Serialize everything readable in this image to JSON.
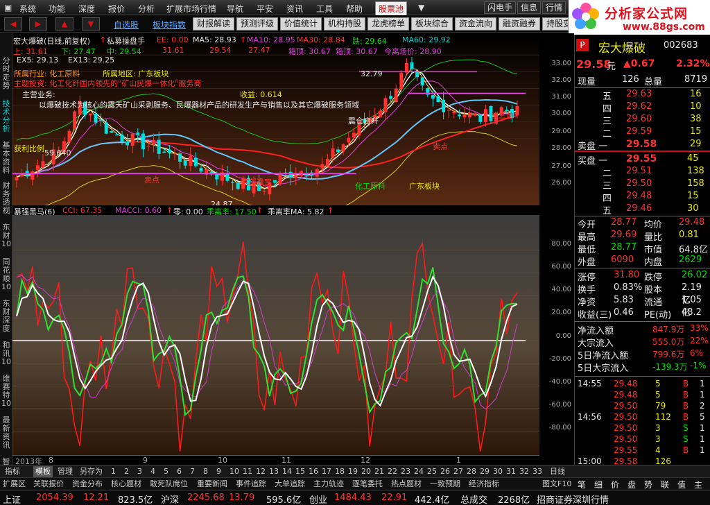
{
  "menu": [
    "系统",
    "功能",
    "深度",
    "报价",
    "分析",
    "扩展市场行情",
    "导航",
    "平安",
    "资讯",
    "工具",
    "帮助"
  ],
  "menu_highlight": "股票池",
  "menu_right": [
    "闪电手",
    "信息",
    "行情"
  ],
  "logo": {
    "title": "分析家公式网",
    "url": "www.88gs.com"
  },
  "toolbar": {
    "arrows": [
      "◀",
      "▶",
      "▲",
      "▼"
    ],
    "links": [
      "自选股",
      "板块指数"
    ],
    "tabs": [
      "财报解读",
      "预测评级",
      "价值统计",
      "机构持股",
      "龙虎榜单",
      "板块综合",
      "资金流向",
      "融资融券",
      "持股变"
    ]
  },
  "left_tabs": [
    "分时走势",
    "技术分析",
    "基本资料",
    "财务透视",
    "东财10",
    "同花顺10",
    "东财深度",
    "和讯10",
    "维赛特10",
    "最新资讯",
    "智能"
  ],
  "main_header": {
    "stock": "宏大爆破(日线,前复权)",
    "tool": "私募操盘手",
    "ee": "EE: 0.00",
    "ma5": "MA5: 28.93",
    "ma10": "MA10: 28.95",
    "ma30": "MA30: 28.84",
    "die": "跌: 29.64",
    "ma60": "MA60: 29.92",
    "shang": "上: 31.61",
    "xia": "下: 27.47",
    "zhong": "中: 29.54",
    "v1": "31.61",
    "v2": "29.54",
    "v3": "27.47",
    "xiangding": "箱顶: 30.67",
    "xiangdi": "箱顶: 30.67",
    "jinlichang": "今离场价: 28.90",
    "ex5": "EX5: 29.13",
    "ex13": "EX13: 29.25"
  },
  "chart_ann": {
    "industry": "所属行业: 化工原料",
    "region": "所属地区: 广东板块",
    "theme": "主题投资: 化工化纤国内领先的\"矿山民爆一体化\"服务商",
    "business_label": "主营业务:",
    "business": "以爆破技术为核心的露天矿山采剥服务、民爆器材产品的研发生产与销售以及其它爆破服务领域",
    "income": "收益: 0.614",
    "ratio": "获利比例",
    "ratio_val": "59.640",
    "high_label": "32.79",
    "low_label": "24.87",
    "cang": "震仓启升",
    "chemical": "化工原料",
    "guangdong": "广东板块",
    "sell1": "卖点",
    "sell2": "卖点",
    "buy": "底部逢宝",
    "zhang": "涨三角"
  },
  "indicator_header": {
    "name": "暴强黑马(6)",
    "cci": "CCI: 67.35",
    "macci": "MACCI: 0.60",
    "zero": "零: 0.00",
    "guai": "乖离率: 17.50",
    "guaima": "乖离率MA: 5.82"
  },
  "price_axis": [
    "33.00",
    "32.00",
    "31.00",
    "30.00",
    "29.00",
    "28.00",
    "27.00",
    "26.00"
  ],
  "ind_axis": [
    "80.00",
    "60.00",
    "40.00",
    "20.00",
    "0.00",
    "-20.00",
    "-40.00",
    "-60.00",
    "-80.00"
  ],
  "time_axis": [
    "2013年",
    "8",
    "9",
    "10",
    "11",
    "12",
    "1"
  ],
  "bottom_tabs": [
    "指标",
    "模板",
    "管理",
    "另存为"
  ],
  "bottom_nums": [
    "1",
    "2",
    "3",
    "4",
    "5",
    "6",
    "7",
    "8",
    "9",
    "10",
    "11",
    "12",
    "13",
    "14",
    "15",
    "16",
    "17",
    "18",
    "19",
    "20",
    "21",
    "22",
    "23",
    "24",
    "25",
    "26",
    "27",
    "28",
    "29",
    "30",
    "31",
    "32",
    "33"
  ],
  "day_label": "日线",
  "bottom_tabs2": [
    "扩展区",
    "关联报价",
    "资金分布",
    "核心题材",
    "敢死队席位",
    "重要新闻",
    "事件追踪",
    "大单追踪",
    "主力轨迹",
    "逐笔委托",
    "热点题材",
    "一致预期",
    "经济指标"
  ],
  "bottom_right2": "图文F10",
  "status": {
    "sh": "上证",
    "sh_v": "2054.39",
    "sh_c": "12.21",
    "sh_a": "823.5亿",
    "hs": "沪深",
    "hs_v": "2245.68",
    "hs_c": "13.79",
    "hs_a": "595.6亿",
    "cy": "创业",
    "cy_v": "1484.43",
    "cy_c": "22.91",
    "cy_a": "442.4亿",
    "total": "总成交",
    "total_v": "2268亿",
    "broker": "招商证券深圳行情"
  },
  "quote": {
    "flag": "P",
    "name": "宏大爆破",
    "code": "002683",
    "price": "29.58",
    "unit": "元",
    "change": "▲0.67",
    "pct": "2.32%",
    "xianliang_l": "现量",
    "xianliang": "126",
    "zongliang_l": "总量",
    "zongliang": "8719",
    "asks": [
      {
        "l": "五",
        "p": "29.63",
        "v": "16"
      },
      {
        "l": "四",
        "p": "29.62",
        "v": "10"
      },
      {
        "l": "三",
        "p": "29.60",
        "v": "38"
      },
      {
        "l": "二",
        "p": "29.59",
        "v": "15"
      },
      {
        "l": "卖盘 一",
        "p": "29.58",
        "v": "29"
      }
    ],
    "bids": [
      {
        "l": "买盘 一",
        "p": "29.55",
        "v": "45"
      },
      {
        "l": "二",
        "p": "29.51",
        "v": "138"
      },
      {
        "l": "三",
        "p": "29.50",
        "v": "158"
      },
      {
        "l": "四",
        "p": "29.48",
        "v": "15"
      },
      {
        "l": "五",
        "p": "29.46",
        "v": "30"
      }
    ],
    "stats": [
      [
        "今开",
        "28.77",
        "均价",
        "29.48"
      ],
      [
        "最高",
        "29.69",
        "量比",
        "0.81"
      ],
      [
        "最低",
        "28.77",
        "市值",
        "64.8亿"
      ],
      [
        "外盘",
        "6090",
        "内盘",
        "2629"
      ]
    ],
    "stats2": [
      [
        "涨停",
        "31.80",
        "跌停",
        "26.02"
      ],
      [
        "换手",
        "0.83%",
        "股本",
        "2.19亿"
      ],
      [
        "净资",
        "5.83",
        "流通",
        "1.05亿"
      ],
      [
        "收益(三)",
        "0.46",
        "PE(动)",
        "48.2"
      ]
    ],
    "flows": [
      [
        "净流入额",
        "847.9万",
        "33%"
      ],
      [
        "大宗流入",
        "555.0万",
        "22%"
      ],
      [
        "5日净流入额",
        "799.6万",
        "6%"
      ],
      [
        "5日大宗流入",
        "-139.3万",
        "-1%"
      ]
    ],
    "ticks": [
      [
        "14:55",
        "29.48",
        "5",
        "B",
        "1"
      ],
      [
        "",
        "29.48",
        "5",
        "B",
        "1"
      ],
      [
        "",
        "29.50",
        "79",
        "B",
        "2"
      ],
      [
        "14:56",
        "29.50",
        "112",
        "B",
        "5"
      ],
      [
        "",
        "29.50",
        "3",
        "S",
        "1"
      ],
      [
        "",
        "29.50",
        "3",
        "S",
        "1"
      ],
      [
        "",
        "29.55",
        "4",
        "B",
        "1"
      ],
      [
        "15:00",
        "29.58",
        "126",
        "",
        ""
      ]
    ],
    "tick_tabs": [
      "笔",
      "细",
      "价",
      "盘",
      "势",
      "联",
      "值",
      "主"
    ]
  }
}
